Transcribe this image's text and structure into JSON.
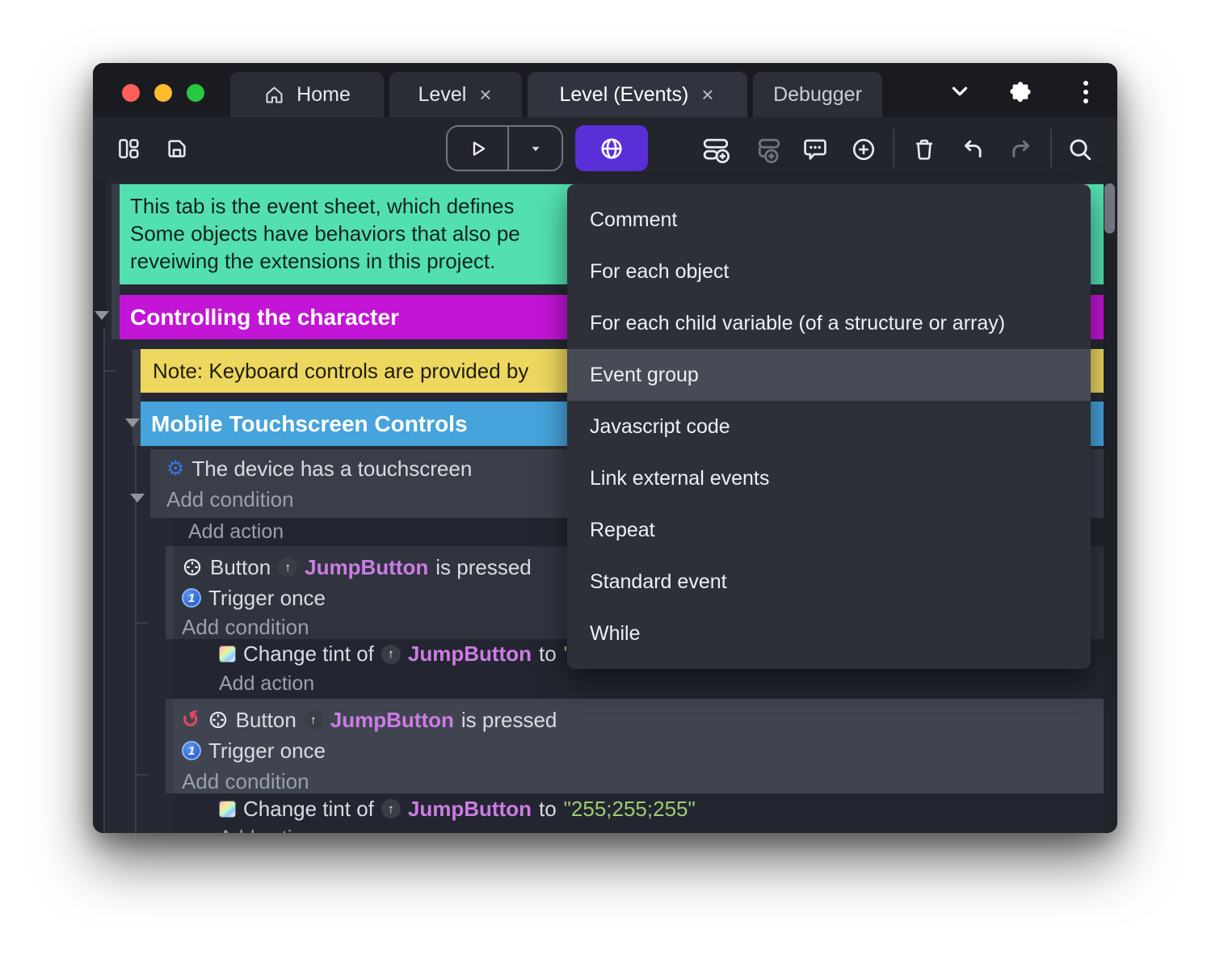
{
  "titlebar": {
    "tabs": {
      "home": "Home",
      "level": "Level",
      "level_events": "Level (Events)",
      "debugger": "Debugger"
    }
  },
  "icons": {
    "close": "×",
    "up_badge": "↑",
    "gear": "⚙",
    "invert": "↺",
    "trigger_once": "1"
  },
  "sheet": {
    "comment": {
      "line1": "This tab is the event sheet, which defines",
      "line2": "Some objects have behaviors that also pe",
      "line3": "reveiwing the extensions in this project."
    },
    "group_controlling": "Controlling the character",
    "note": "Note: Keyboard controls are provided by",
    "group_mobile": "Mobile Touchscreen Controls",
    "links": {
      "add_condition": "Add condition",
      "add_action": "Add action"
    },
    "device_condition": "The device has a touchscreen",
    "button_event": {
      "object": "Button",
      "instance": "JumpButton",
      "predicate": "is pressed",
      "trigger": "Trigger once"
    },
    "tint_action": {
      "verb": "Change tint of",
      "instance": "JumpButton",
      "to": "to",
      "value": "\"255;255;255\""
    }
  },
  "menu": {
    "items": [
      "Comment",
      "For each object",
      "For each child variable (of a structure or array)",
      "Event group",
      "Javascript code",
      "Link external events",
      "Repeat",
      "Standard event",
      "While"
    ],
    "highlighted": "Event group"
  },
  "colors": {
    "accent_purple": "#5a2fd8",
    "group_magenta": "#c215d6",
    "note_yellow": "#eed75f",
    "group_blue": "#46a3db",
    "comment_green": "#53e0b1",
    "object_violet": "#cd7ce4",
    "string_green": "#9dcc70",
    "invert_red": "#e2475f",
    "trigger_blue": "#2668d8",
    "traffic_red": "#fe5f57",
    "traffic_yellow": "#febc2e",
    "traffic_green": "#28c840"
  }
}
